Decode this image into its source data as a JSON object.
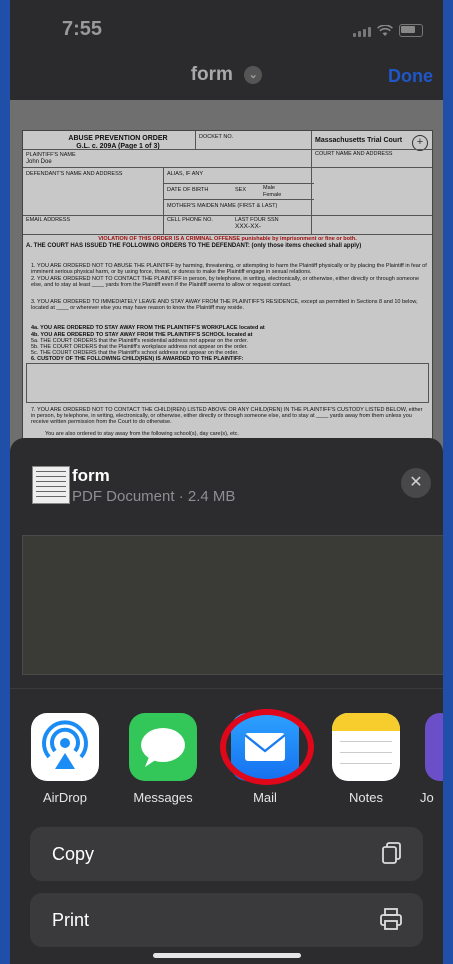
{
  "status": {
    "time": "7:55"
  },
  "header": {
    "title": "form",
    "done_label": "Done"
  },
  "document": {
    "title_line1": "ABUSE PREVENTION ORDER",
    "title_line2": "G.L. c. 209A (Page 1 of 3)",
    "docket": "DOCKET NO.",
    "court": "Massachusetts Trial Court",
    "court_name": "COURT NAME AND ADDRESS",
    "plaintiff_label": "PLAINTIFF'S NAME",
    "plaintiff_value": "John Doe",
    "defendant_label": "DEFENDANT'S NAME AND ADDRESS",
    "alias": "ALIAS, IF ANY",
    "dob": "DATE OF BIRTH",
    "sex": "SEX",
    "male": "Male",
    "female": "Female",
    "maiden": "MOTHER'S MAIDEN NAME (FIRST & LAST)",
    "email": "EMAIL ADDRESS",
    "cell": "CELL PHONE NO.",
    "ssn_label": "LAST FOUR SSN",
    "ssn_value": "XXX-XX-",
    "violation": "VIOLATION OF THIS ORDER IS A CRIMINAL OFFENSE punishable by imprisonment or fine or both.",
    "section_a": "A. THE COURT HAS ISSUED THE FOLLOWING ORDERS TO THE DEFENDANT: (only those items checked shall apply)",
    "item1": "1. YOU ARE ORDERED NOT TO ABUSE THE PLAINTIFF by harming, threatening, or attempting to harm the Plaintiff physically or by placing the Plaintiff in fear of imminent serious physical harm, or by using force, threat, or duress to make the Plaintiff engage in sexual relations.",
    "item2": "2. YOU ARE ORDERED NOT TO CONTACT THE PLAINTIFF in person, by telephone, in writing, electronically, or otherwise, either directly or through someone else, and to stay at least ____ yards from the Plaintiff even if the Plaintiff seems to allow or request contact.",
    "item3": "3. YOU ARE ORDERED TO IMMEDIATELY LEAVE AND STAY AWAY FROM THE PLAINTIFF'S RESIDENCE, except as permitted in Sections 8 and 10 below, located at ____ or wherever else you may have reason to know the Plaintiff may reside.",
    "item4a": "4a. YOU ARE ORDERED TO STAY AWAY FROM THE PLAINTIFF'S WORKPLACE located at",
    "item4b": "4b. YOU ARE ORDERED TO STAY AWAY FROM THE PLAINTIFF'S SCHOOL located at",
    "item5a": "5a. THE COURT ORDERS that the Plaintiff's residential address not appear on the order.",
    "item5b": "5b. THE COURT ORDERS that the Plaintiff's workplace address not appear on the order.",
    "item5c": "5c. THE COURT ORDERS that the Plaintiff's school address not appear on the order.",
    "item6": "6. CUSTODY OF THE FOLLOWING CHILD(REN) IS AWARDED TO THE PLAINTIFF:",
    "item7": "7. YOU ARE ORDERED NOT TO CONTACT THE CHILD(REN) LISTED ABOVE OR ANY CHILD(REN) IN THE PLAINTIFF'S CUSTODY LISTED BELOW, either in person, by telephone, in writing, electronically, or otherwise, either directly or through someone else, and to stay at ____ yards away from them unless you receive written permission from the Court to do otherwise.",
    "item7b": "You are also ordered to stay away from the following school(s), day care(s), etc."
  },
  "sheet": {
    "file_name": "form",
    "file_meta": "PDF Document · 2.4 MB",
    "apps": [
      {
        "label": "AirDrop",
        "icon": "airdrop-icon"
      },
      {
        "label": "Messages",
        "icon": "messages-icon"
      },
      {
        "label": "Mail",
        "icon": "mail-icon"
      },
      {
        "label": "Notes",
        "icon": "notes-icon"
      },
      {
        "label": "Jo",
        "icon": "app-icon"
      }
    ],
    "actions": [
      {
        "label": "Copy",
        "icon": "copy-icon"
      },
      {
        "label": "Print",
        "icon": "print-icon"
      }
    ]
  }
}
